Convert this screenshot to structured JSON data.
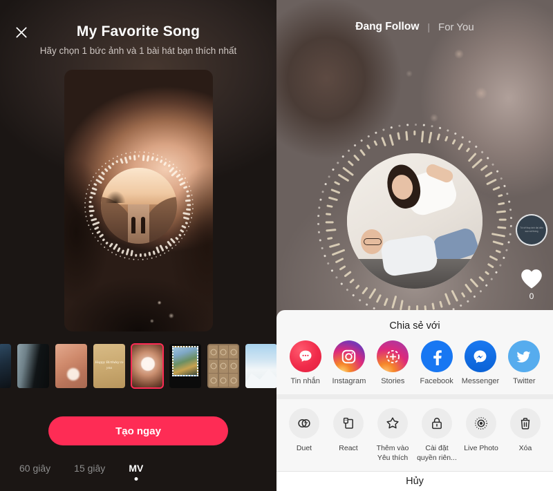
{
  "left_panel": {
    "close_icon": "close-icon",
    "title": "My Favorite Song",
    "subtitle": "Hãy chọn 1 bức ảnh và 1 bài hát bạn thích nhất",
    "preview": {
      "type": "mv-circular-visualizer",
      "description": "Blurred sunset photo background with circular masked photo of a couple holding hands on a bridge, surrounded by a dotted audio-visualizer ring"
    },
    "thumbnails": [
      {
        "name": "thumb-city-partial",
        "selected": false
      },
      {
        "name": "thumb-forest-fog",
        "selected": false
      },
      {
        "name": "thumb-peach-marble",
        "selected": false
      },
      {
        "name": "thumb-happy-birthday",
        "selected": false,
        "text": "Happy Birthday to you"
      },
      {
        "name": "thumb-sunset-couple",
        "selected": true
      },
      {
        "name": "thumb-polaroid-stamp",
        "selected": false
      },
      {
        "name": "thumb-grid-pattern",
        "selected": false
      },
      {
        "name": "thumb-snow-mountain",
        "selected": false
      },
      {
        "name": "thumb-next-partial",
        "selected": false
      }
    ],
    "cta_label": "Tạo ngay",
    "mode_tabs": [
      {
        "label": "60 giây",
        "active": false
      },
      {
        "label": "15 giây",
        "active": false
      },
      {
        "label": "MV",
        "active": true
      }
    ],
    "accent_color": "#FE2C55"
  },
  "right_panel": {
    "feed_tabs": [
      {
        "label": "Đang Follow",
        "active": true
      },
      {
        "label": "For You",
        "active": false
      }
    ],
    "tab_separator": "|",
    "video": {
      "type": "mv-circular-visualizer",
      "description": "Blurred warm background with circular masked photo of a couple sitting together, surrounded by a dotted audio-visualizer ring"
    },
    "rail": {
      "avatar_name": "avatar",
      "avatar_text": "Tôi sẽ thay ảnh đại diện sau vài tháng",
      "like_icon": "heart-icon",
      "like_count": "0"
    },
    "share_sheet": {
      "title": "Chia sẻ với",
      "share_targets": [
        {
          "label": "Tin nhắn",
          "icon": "message-bubble-icon",
          "color": "#F02B4A"
        },
        {
          "label": "Instagram",
          "icon": "instagram-icon",
          "color": "#DD2A7B"
        },
        {
          "label": "Stories",
          "icon": "stories-plus-icon",
          "color": "#DD2A7B"
        },
        {
          "label": "Facebook",
          "icon": "facebook-icon",
          "color": "#1877F2"
        },
        {
          "label": "Messenger",
          "icon": "messenger-icon",
          "color": "#0A62D6"
        },
        {
          "label": "Twitter",
          "icon": "twitter-bird-icon",
          "color": "#56ACEE"
        }
      ],
      "actions": [
        {
          "label": "Duet",
          "icon": "duet-circles-icon"
        },
        {
          "label": "React",
          "icon": "react-frames-icon"
        },
        {
          "label": "Thêm vào Yêu thích",
          "icon": "star-icon"
        },
        {
          "label": "Cài đặt quyền riên...",
          "icon": "lock-icon"
        },
        {
          "label": "Live Photo",
          "icon": "live-photo-icon"
        },
        {
          "label": "Xóa",
          "icon": "trash-icon"
        }
      ],
      "cancel_label": "Hủy"
    }
  }
}
